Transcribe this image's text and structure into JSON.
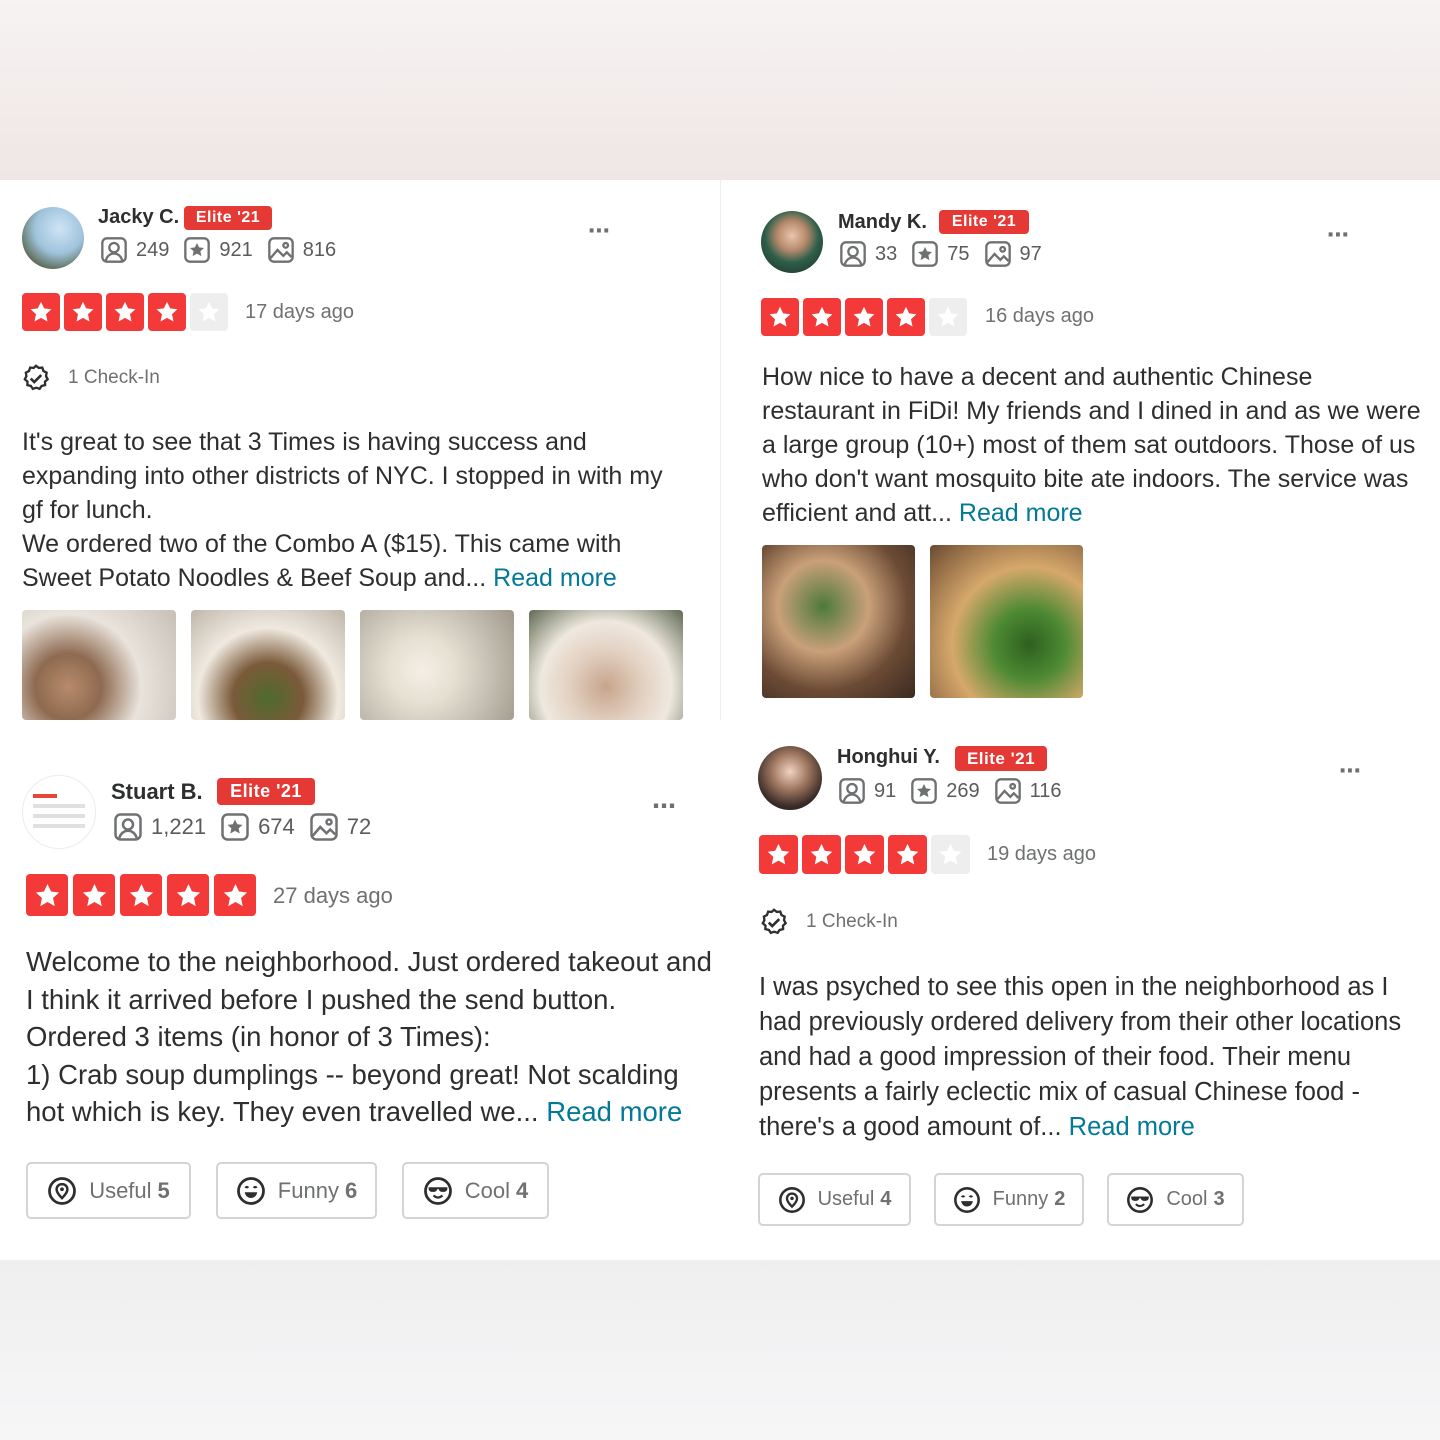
{
  "reviews": [
    {
      "name": "Jacky C.",
      "badge": "Elite '21",
      "friends": "249",
      "reviews": "921",
      "photos": "816",
      "rating": 4,
      "time_ago": "17 days ago",
      "checkin": "1 Check-In",
      "text": "It's great to see that 3 Times is having success and expanding into other districts of NYC. I stopped in with my gf for lunch.\nWe ordered two of the Combo A ($15). This came with Sweet Potato Noodles & Beef Soup and...",
      "read_more": "Read more"
    },
    {
      "name": "Mandy K.",
      "badge": "Elite '21",
      "friends": "33",
      "reviews": "75",
      "photos": "97",
      "rating": 4,
      "time_ago": "16 days ago",
      "text": "How nice to have a decent and authentic Chinese restaurant in FiDi! My friends and I dined in and as we were a large group (10+) most of them sat outdoors. Those of us who don't want mosquito bite ate indoors. The service was efficient and att...",
      "read_more": "Read more"
    },
    {
      "name": "Stuart B.",
      "badge": "Elite '21",
      "friends": "1,221",
      "reviews": "674",
      "photos": "72",
      "rating": 5,
      "time_ago": "27 days ago",
      "text": "Welcome to the neighborhood.  Just ordered takeout and I think it arrived before I pushed the send button. Ordered 3 items (in honor of 3 Times):\n1) Crab soup dumplings -- beyond great!  Not scalding hot which is key.  They even travelled we...",
      "read_more": "Read more",
      "useful_label": "Useful",
      "useful_count": "5",
      "funny_label": "Funny",
      "funny_count": "6",
      "cool_label": "Cool",
      "cool_count": "4"
    },
    {
      "name": "Honghui Y.",
      "badge": "Elite '21",
      "friends": "91",
      "reviews": "269",
      "photos": "116",
      "rating": 4,
      "time_ago": "19 days ago",
      "checkin": "1 Check-In",
      "text": "I was psyched to see this open in the neighborhood as I had previously ordered delivery from their other locations and had a good impression of their food. Their menu presents a fairly eclectic mix of casual Chinese food - there's a good amount of...",
      "read_more": "Read more",
      "useful_label": "Useful",
      "useful_count": "4",
      "funny_label": "Funny",
      "funny_count": "2",
      "cool_label": "Cool",
      "cool_count": "3"
    }
  ],
  "more_icon": "⋯",
  "colors": {
    "star_active": "#f43939",
    "star_inactive": "#eeeeef",
    "elite_badge": "#e53935",
    "link": "#027a97"
  },
  "icons": [
    "friends-icon",
    "reviews-icon",
    "photos-icon",
    "checkin-icon",
    "star-icon",
    "more-icon",
    "useful-icon",
    "funny-icon",
    "cool-icon"
  ]
}
